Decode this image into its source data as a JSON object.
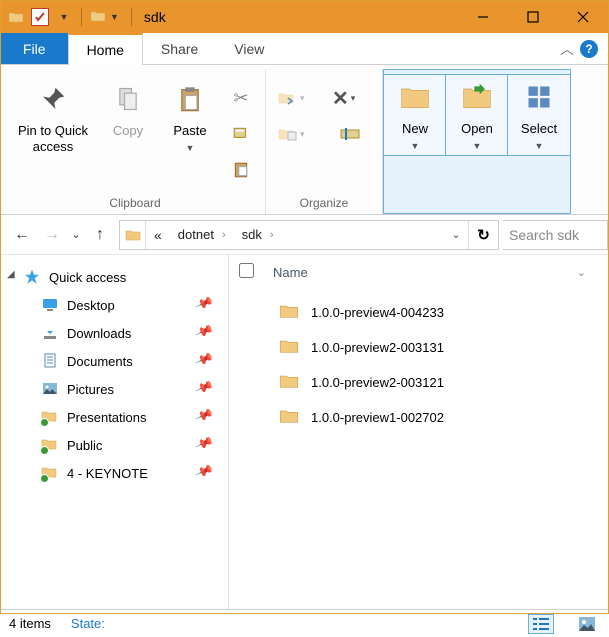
{
  "window": {
    "title": "sdk"
  },
  "tabs": {
    "file": "File",
    "home": "Home",
    "share": "Share",
    "view": "View"
  },
  "ribbon": {
    "clipboard": {
      "pin": "Pin to Quick access",
      "copy": "Copy",
      "paste": "Paste",
      "name": "Clipboard"
    },
    "organize": {
      "name": "Organize"
    },
    "new": "New",
    "open": "Open",
    "select": "Select"
  },
  "breadcrumb": {
    "ellipsis": "«",
    "parent": "dotnet",
    "current": "sdk"
  },
  "search_placeholder": "Search sdk",
  "columns": {
    "name": "Name"
  },
  "nav": {
    "quick_access": "Quick access",
    "items": [
      {
        "label": "Desktop",
        "icon": "desktop"
      },
      {
        "label": "Downloads",
        "icon": "downloads"
      },
      {
        "label": "Documents",
        "icon": "documents"
      },
      {
        "label": "Pictures",
        "icon": "pictures"
      },
      {
        "label": "Presentations",
        "icon": "sync-folder"
      },
      {
        "label": "Public",
        "icon": "sync-folder"
      },
      {
        "label": "4 - KEYNOTE ",
        "icon": "sync-folder"
      }
    ]
  },
  "files": [
    "1.0.0-preview4-004233",
    "1.0.0-preview2-003131",
    "1.0.0-preview2-003121",
    "1.0.0-preview1-002702"
  ],
  "status": {
    "count": "4 items",
    "state_label": "State:"
  }
}
